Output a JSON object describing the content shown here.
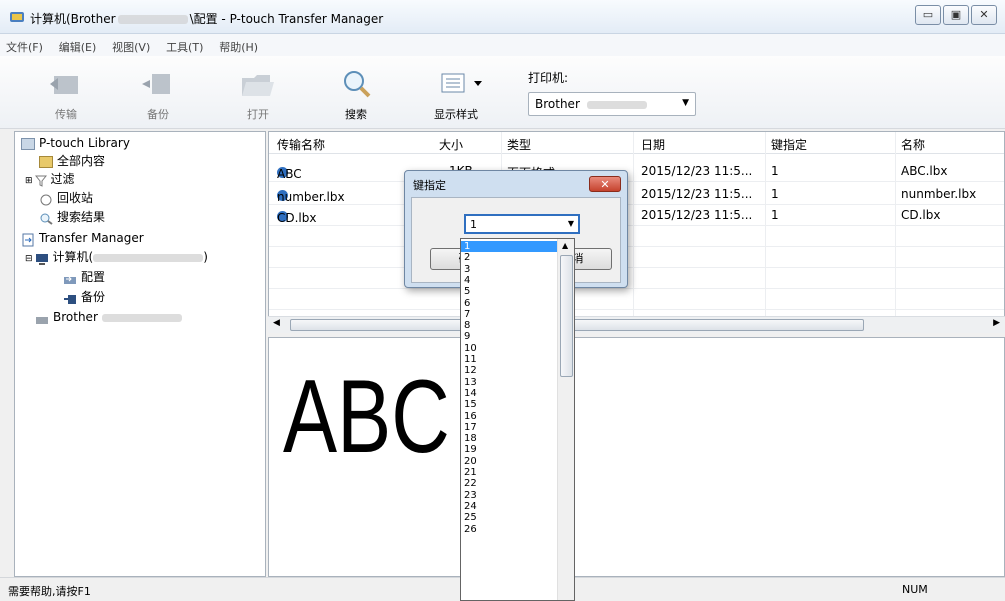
{
  "window": {
    "title_prefix": "计算机(Brother",
    "title_suffix": "\\配置 - P-touch Transfer Manager",
    "buttons": [
      "▭",
      "▣",
      "✕"
    ]
  },
  "menu": [
    "文件(F)",
    "编辑(E)",
    "视图(V)",
    "工具(T)",
    "帮助(H)"
  ],
  "toolbar": {
    "transfer": "传输",
    "backup": "备份",
    "open": "打开",
    "search": "搜索",
    "view_style": "显示样式",
    "printer_label": "打印机:",
    "printer_value": "Brother"
  },
  "tree": {
    "library": "P-touch Library",
    "all": "全部内容",
    "filter": "过滤",
    "recycle": "回收站",
    "search_results": "搜索结果",
    "transfer_manager": "Transfer Manager",
    "computer": "计算机(",
    "config": "配置",
    "backup": "备份",
    "brother": "Brother"
  },
  "list": {
    "headers": [
      "传输名称",
      "大小",
      "类型",
      "日期",
      "键指定",
      "名称"
    ],
    "rows": [
      {
        "name": "ABC",
        "size": "1KB",
        "type": "页面格式",
        "date": "2015/12/23 11:5...",
        "key": "1",
        "file": "ABC.lbx"
      },
      {
        "name": "number.lbx",
        "size": "",
        "type": "",
        "date": "2015/12/23 11:5...",
        "key": "1",
        "file": "nunmber.lbx"
      },
      {
        "name": "CD.lbx",
        "size": "",
        "type": "",
        "date": "2015/12/23 11:5...",
        "key": "1",
        "file": "CD.lbx"
      }
    ]
  },
  "preview": {
    "text": "ABC"
  },
  "status": {
    "help": "需要帮助,请按F1",
    "num": "NUM"
  },
  "dialog": {
    "title": "键指定",
    "close": "✕",
    "selected": "1",
    "ok": "确",
    "cancel": "消"
  },
  "dropdown": {
    "options": [
      "1",
      "2",
      "3",
      "4",
      "5",
      "6",
      "7",
      "8",
      "9",
      "10",
      "11",
      "12",
      "13",
      "14",
      "15",
      "16",
      "17",
      "18",
      "19",
      "20",
      "21",
      "22",
      "23",
      "24",
      "25",
      "26"
    ]
  },
  "colors": {
    "accent": "#3399ff",
    "close_red": "#c5432e",
    "dialog_bg": "#cfdff0"
  }
}
